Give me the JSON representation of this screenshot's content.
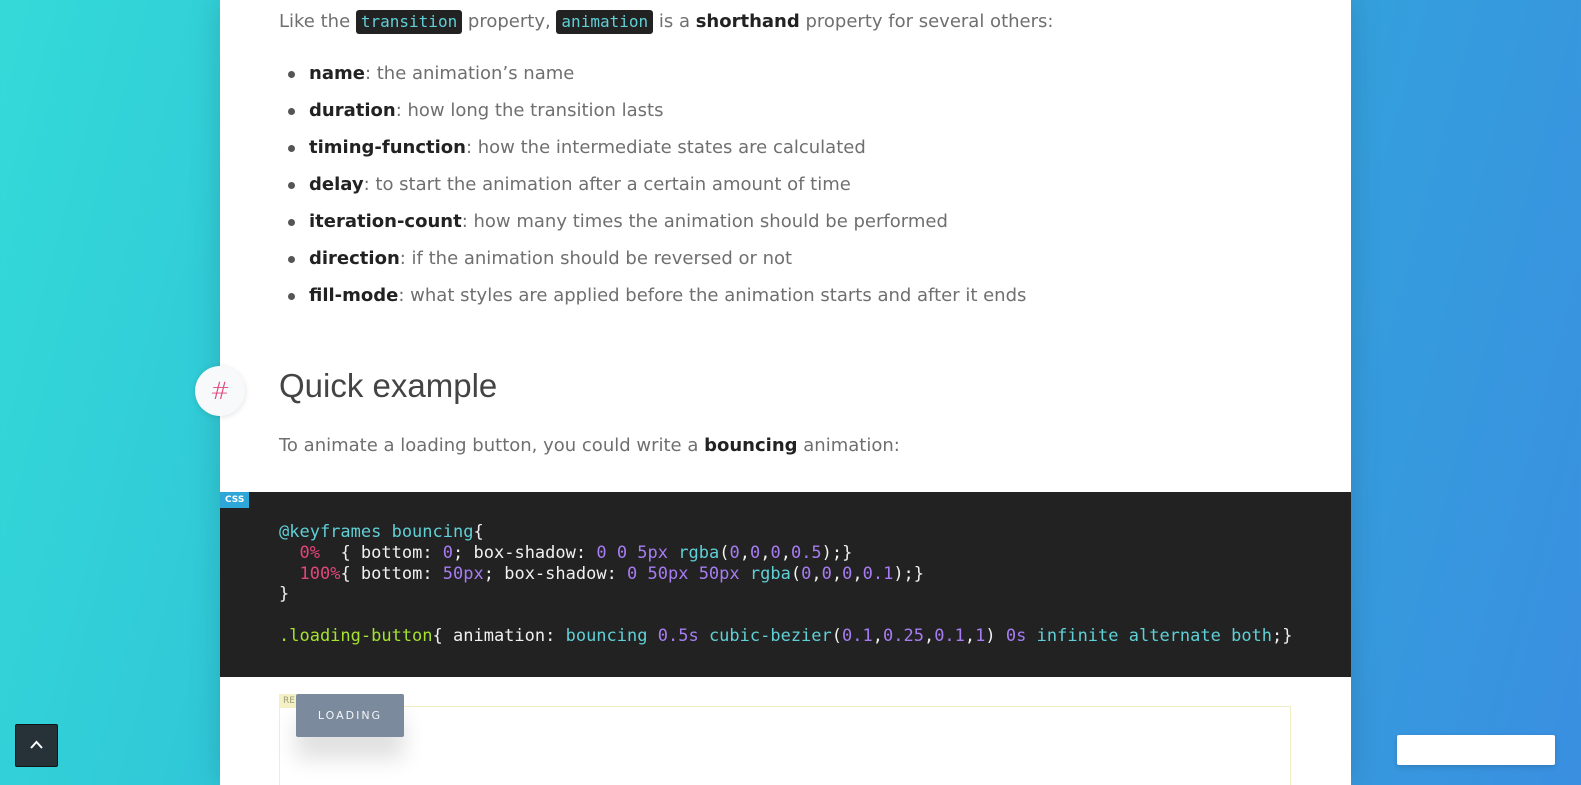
{
  "intro": {
    "prefix": "Like the ",
    "code1": "transition",
    "mid1": " property, ",
    "code2": "animation",
    "mid2": " is a ",
    "bold": "shorthand",
    "suffix": " property for several others:"
  },
  "properties": [
    {
      "name": "name",
      "desc": ": the animation’s name"
    },
    {
      "name": "duration",
      "desc": ": how long the transition lasts"
    },
    {
      "name": "timing-function",
      "desc": ": how the intermediate states are calculated"
    },
    {
      "name": "delay",
      "desc": ": to start the animation after a certain amount of time"
    },
    {
      "name": "iteration-count",
      "desc": ": how many times the animation should be performed"
    },
    {
      "name": "direction",
      "desc": ": if the animation should be reversed or not"
    },
    {
      "name": "fill-mode",
      "desc": ": what styles are applied before the animation starts and after it ends"
    }
  ],
  "section": {
    "anchor": "#",
    "heading": "Quick example",
    "lead_prefix": "To animate a loading button, you could write a ",
    "lead_bold": "bouncing",
    "lead_suffix": " animation:"
  },
  "code": {
    "language": "CSS",
    "lines": {
      "l1_at": "@keyframes bouncing",
      "l1_brace": "{",
      "l2_pct": "0%",
      "l2_a": "  { bottom: ",
      "l2_n1": "0",
      "l2_b": "; box-shadow: ",
      "l2_n2": "0 0 5px",
      "l2_sp": " ",
      "l2_fn": "rgba",
      "l2_c": "(",
      "l2_n3": "0",
      "l2_d": ",",
      "l2_n4": "0",
      "l2_e": ",",
      "l2_n5": "0",
      "l2_f": ",",
      "l2_n6": "0.5",
      "l2_g": ");}",
      "l3_pct": "100%",
      "l3_a": "{ bottom: ",
      "l3_n1": "50px",
      "l3_b": "; box-shadow: ",
      "l3_n2": "0 50px 50px",
      "l3_sp": " ",
      "l3_fn": "rgba",
      "l3_c": "(",
      "l3_n3": "0",
      "l3_d": ",",
      "l3_n4": "0",
      "l3_e": ",",
      "l3_n5": "0",
      "l3_f": ",",
      "l3_n6": "0.1",
      "l3_g": ");}",
      "l4": "}",
      "l6_sel": ".loading-button",
      "l6_a": "{ animation: ",
      "l6_name": "bouncing",
      "l6_sp1": " ",
      "l6_dur": "0.5s",
      "l6_sp2": " ",
      "l6_fn": "cubic-bezier",
      "l6_c": "(",
      "l6_n1": "0.1",
      "l6_d": ",",
      "l6_n2": "0.25",
      "l6_e": ",",
      "l6_n3": "0.1",
      "l6_f": ",",
      "l6_n4": "1",
      "l6_g": ") ",
      "l6_delay": "0s",
      "l6_sp3": " ",
      "l6_kw": "infinite alternate both",
      "l6_h": ";}"
    }
  },
  "result": {
    "tag": "RE",
    "button_label": "LOADING"
  },
  "back_to_top": {
    "icon": "chevron-up-icon"
  },
  "corner_input": {
    "value": ""
  },
  "colors": {
    "accent_pink": "#e0457b",
    "code_cyan": "#5fd0d6",
    "code_purple": "#a77cf2",
    "code_green": "#a6e22e",
    "code_bg": "#222222",
    "tag_blue": "#2ea7d8"
  }
}
